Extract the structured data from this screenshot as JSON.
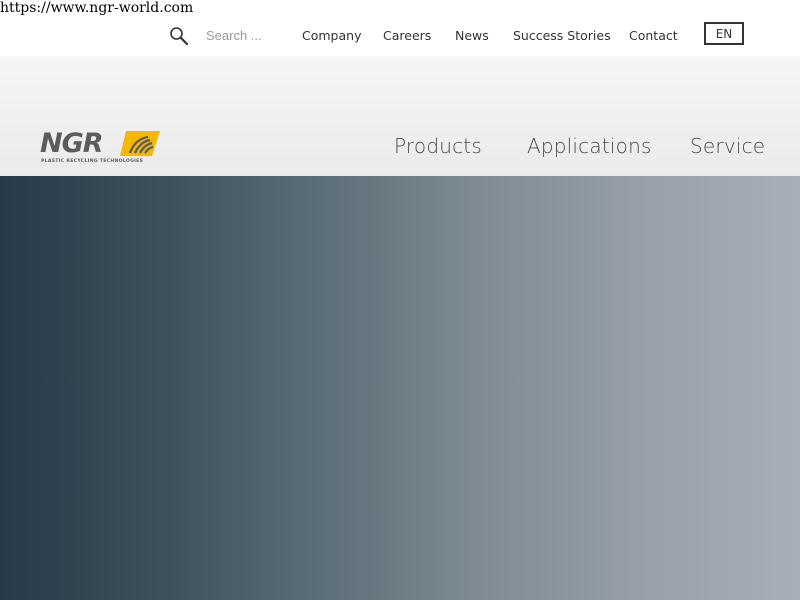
{
  "browser": {
    "url": "https://www.ngr-world.com"
  },
  "topbar": {
    "search": {
      "icon": "search-icon",
      "placeholder": "Search ..."
    },
    "links": {
      "company": "Company",
      "careers": "Careers",
      "news": "News",
      "success_stories": "Success Stories",
      "contact": "Contact"
    },
    "language": "EN"
  },
  "header": {
    "logo": {
      "text": "NGR",
      "tagline": "PLASTIC RECYCLING TECHNOLOGIES",
      "brand_color": "#f5b800",
      "text_color": "#5a5c5e"
    },
    "nav": {
      "products": "Products",
      "applications": "Applications",
      "service": "Service"
    }
  },
  "hero": {
    "gradient_start": "#273b48",
    "gradient_end": "#a6aeb8"
  }
}
